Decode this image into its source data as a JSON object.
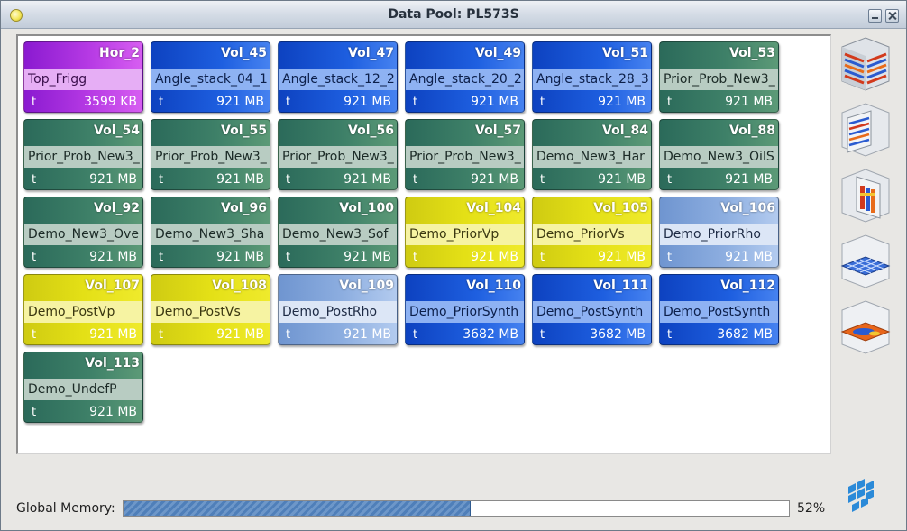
{
  "window": {
    "title": "Data Pool: PL573S"
  },
  "tiles": [
    {
      "name": "Hor_2",
      "desc": "Top_Frigg",
      "type": "t",
      "size": "3599 KB",
      "color": "purple"
    },
    {
      "name": "Vol_45",
      "desc": "Angle_stack_04_1",
      "type": "t",
      "size": "921 MB",
      "color": "blue"
    },
    {
      "name": "Vol_47",
      "desc": "Angle_stack_12_2",
      "type": "t",
      "size": "921 MB",
      "color": "blue"
    },
    {
      "name": "Vol_49",
      "desc": "Angle_stack_20_2",
      "type": "t",
      "size": "921 MB",
      "color": "blue"
    },
    {
      "name": "Vol_51",
      "desc": "Angle_stack_28_3",
      "type": "t",
      "size": "921 MB",
      "color": "blue"
    },
    {
      "name": "Vol_53",
      "desc": "Prior_Prob_New3_",
      "type": "t",
      "size": "921 MB",
      "color": "green"
    },
    {
      "name": "Vol_54",
      "desc": "Prior_Prob_New3_",
      "type": "t",
      "size": "921 MB",
      "color": "green"
    },
    {
      "name": "Vol_55",
      "desc": "Prior_Prob_New3_",
      "type": "t",
      "size": "921 MB",
      "color": "green"
    },
    {
      "name": "Vol_56",
      "desc": "Prior_Prob_New3_",
      "type": "t",
      "size": "921 MB",
      "color": "green"
    },
    {
      "name": "Vol_57",
      "desc": "Prior_Prob_New3_",
      "type": "t",
      "size": "921 MB",
      "color": "green"
    },
    {
      "name": "Vol_84",
      "desc": "Demo_New3_Har",
      "type": "t",
      "size": "921 MB",
      "color": "green"
    },
    {
      "name": "Vol_88",
      "desc": "Demo_New3_OilS",
      "type": "t",
      "size": "921 MB",
      "color": "green"
    },
    {
      "name": "Vol_92",
      "desc": "Demo_New3_Ove",
      "type": "t",
      "size": "921 MB",
      "color": "green"
    },
    {
      "name": "Vol_96",
      "desc": "Demo_New3_Sha",
      "type": "t",
      "size": "921 MB",
      "color": "green"
    },
    {
      "name": "Vol_100",
      "desc": "Demo_New3_Sof",
      "type": "t",
      "size": "921 MB",
      "color": "green"
    },
    {
      "name": "Vol_104",
      "desc": "Demo_PriorVp",
      "type": "t",
      "size": "921 MB",
      "color": "yellow"
    },
    {
      "name": "Vol_105",
      "desc": "Demo_PriorVs",
      "type": "t",
      "size": "921 MB",
      "color": "yellow"
    },
    {
      "name": "Vol_106",
      "desc": "Demo_PriorRho",
      "type": "t",
      "size": "921 MB",
      "color": "lightblue"
    },
    {
      "name": "Vol_107",
      "desc": "Demo_PostVp",
      "type": "t",
      "size": "921 MB",
      "color": "yellow"
    },
    {
      "name": "Vol_108",
      "desc": "Demo_PostVs",
      "type": "t",
      "size": "921 MB",
      "color": "yellow"
    },
    {
      "name": "Vol_109",
      "desc": "Demo_PostRho",
      "type": "t",
      "size": "921 MB",
      "color": "lightblue"
    },
    {
      "name": "Vol_110",
      "desc": "Demo_PriorSynth",
      "type": "t",
      "size": "3682 MB",
      "color": "blue"
    },
    {
      "name": "Vol_111",
      "desc": "Demo_PostSynth",
      "type": "t",
      "size": "3682 MB",
      "color": "blue"
    },
    {
      "name": "Vol_112",
      "desc": "Demo_PostSynth",
      "type": "t",
      "size": "3682 MB",
      "color": "blue"
    },
    {
      "name": "Vol_113",
      "desc": "Demo_UndefP",
      "type": "t",
      "size": "921 MB",
      "color": "green"
    }
  ],
  "side_icons": [
    "volume-slices-icon",
    "crossline-section-icon",
    "inline-section-icon",
    "timeslice-grid-icon",
    "horizon-map-icon"
  ],
  "memory": {
    "label": "Global Memory:",
    "value_percent": 52,
    "percent_text": "52%"
  },
  "colors": {
    "green": "#2b6a5a",
    "blue": "#1e5fe0",
    "yellow": "#e4e016",
    "lightblue": "#8daee0",
    "purple": "#b63ae4"
  }
}
